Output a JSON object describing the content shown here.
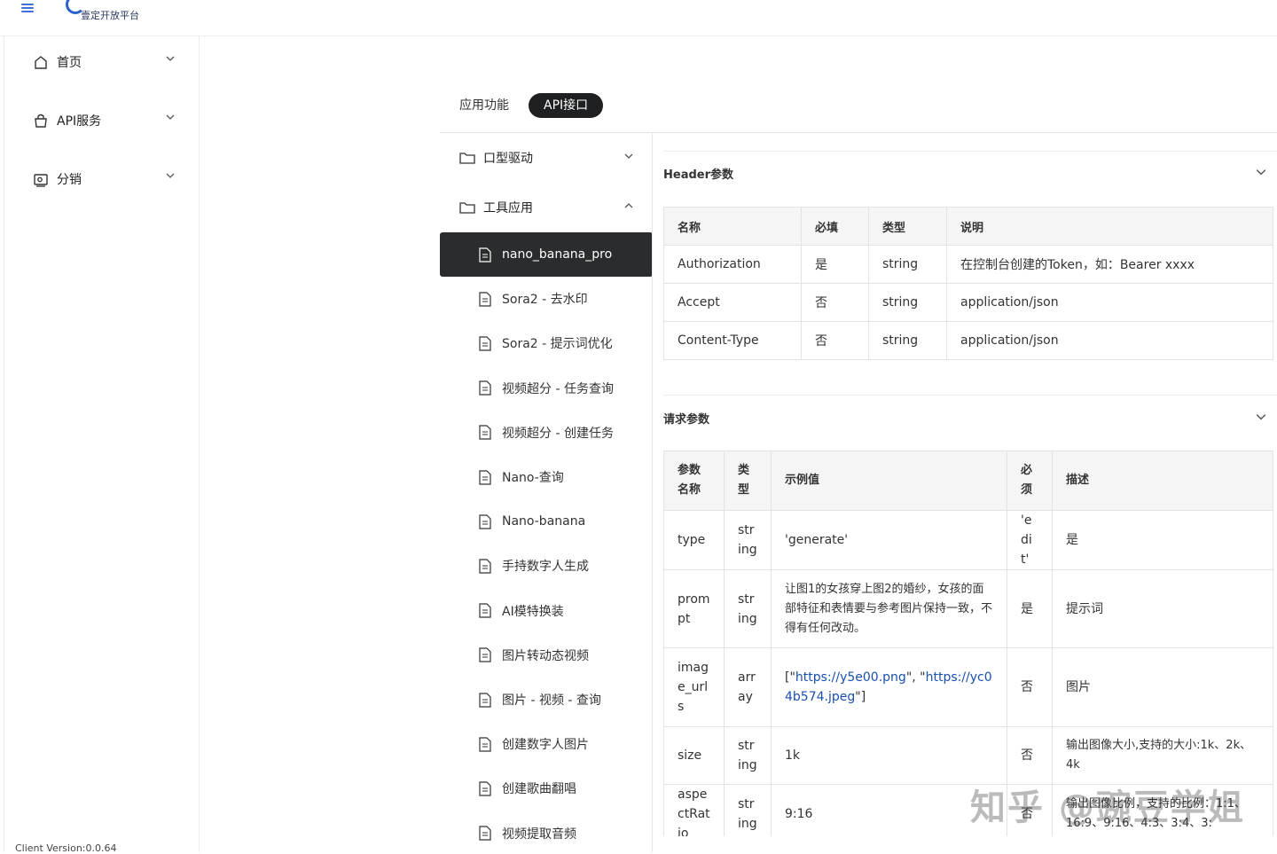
{
  "app": {
    "logo_text": "壹定开放平台",
    "version": "Client Version:0.0.64"
  },
  "sidebar": {
    "items": [
      {
        "label": "首页",
        "icon": "home-icon"
      },
      {
        "label": "API服务",
        "icon": "bag-icon"
      },
      {
        "label": "分销",
        "icon": "wallet-icon"
      }
    ]
  },
  "tabs": [
    {
      "label": "应用功能",
      "active": false
    },
    {
      "label": "API接口",
      "active": true
    }
  ],
  "tree": {
    "folders": [
      {
        "label": "口型驱动",
        "expanded": false
      },
      {
        "label": "工具应用",
        "expanded": true
      }
    ],
    "leaves": [
      "nano_banana_pro",
      "Sora2 - 去水印",
      "Sora2 - 提示词优化",
      "视频超分 - 任务查询",
      "视频超分 - 创建任务",
      "Nano-查询",
      "Nano-banana",
      "手持数字人生成",
      "AI模特换装",
      "图片转动态视频",
      "图片 - 视频 - 查询",
      "创建数字人图片",
      "创建歌曲翻唱",
      "视频提取音频"
    ]
  },
  "header_params": {
    "title": "Header参数",
    "columns": [
      "名称",
      "必填",
      "类型",
      "说明"
    ],
    "rows": [
      [
        "Authorization",
        "是",
        "string",
        "在控制台创建的Token，如：Bearer xxxx"
      ],
      [
        "Accept",
        "否",
        "string",
        "application/json"
      ],
      [
        "Content-Type",
        "否",
        "string",
        "application/json"
      ]
    ]
  },
  "request_params": {
    "title": "请求参数",
    "columns": [
      "参数名称",
      "类型",
      "示例值",
      "必须",
      "描述"
    ],
    "rows": [
      [
        "type",
        "string",
        "'generate'",
        "'edit'",
        "是"
      ],
      [
        "prompt",
        "string",
        "让图1的女孩穿上图2的婚纱，女孩的面部特征和表情要与参考图片保持一致，不得有任何改动。",
        "是",
        "提示词"
      ],
      [
        "image_urls",
        "array",
        "",
        "否",
        "图片"
      ],
      [
        "size",
        "string",
        "1k",
        "否",
        "输出图像大小,支持的大小:1k、2k、4k"
      ],
      [
        "aspectRatio",
        "string",
        "9:16",
        "否",
        "输出图像比例，支持的比例：1:1、16:9、9:16、4:3、3:4、3:"
      ]
    ],
    "image_urls_example": {
      "open": "[\"",
      "url1": "https://y5e00.png",
      "mid": "\", \"",
      "url2": "https://yc04b574.jpeg",
      "close": "\"]"
    }
  },
  "watermark": "知乎 @豌豆学姐"
}
